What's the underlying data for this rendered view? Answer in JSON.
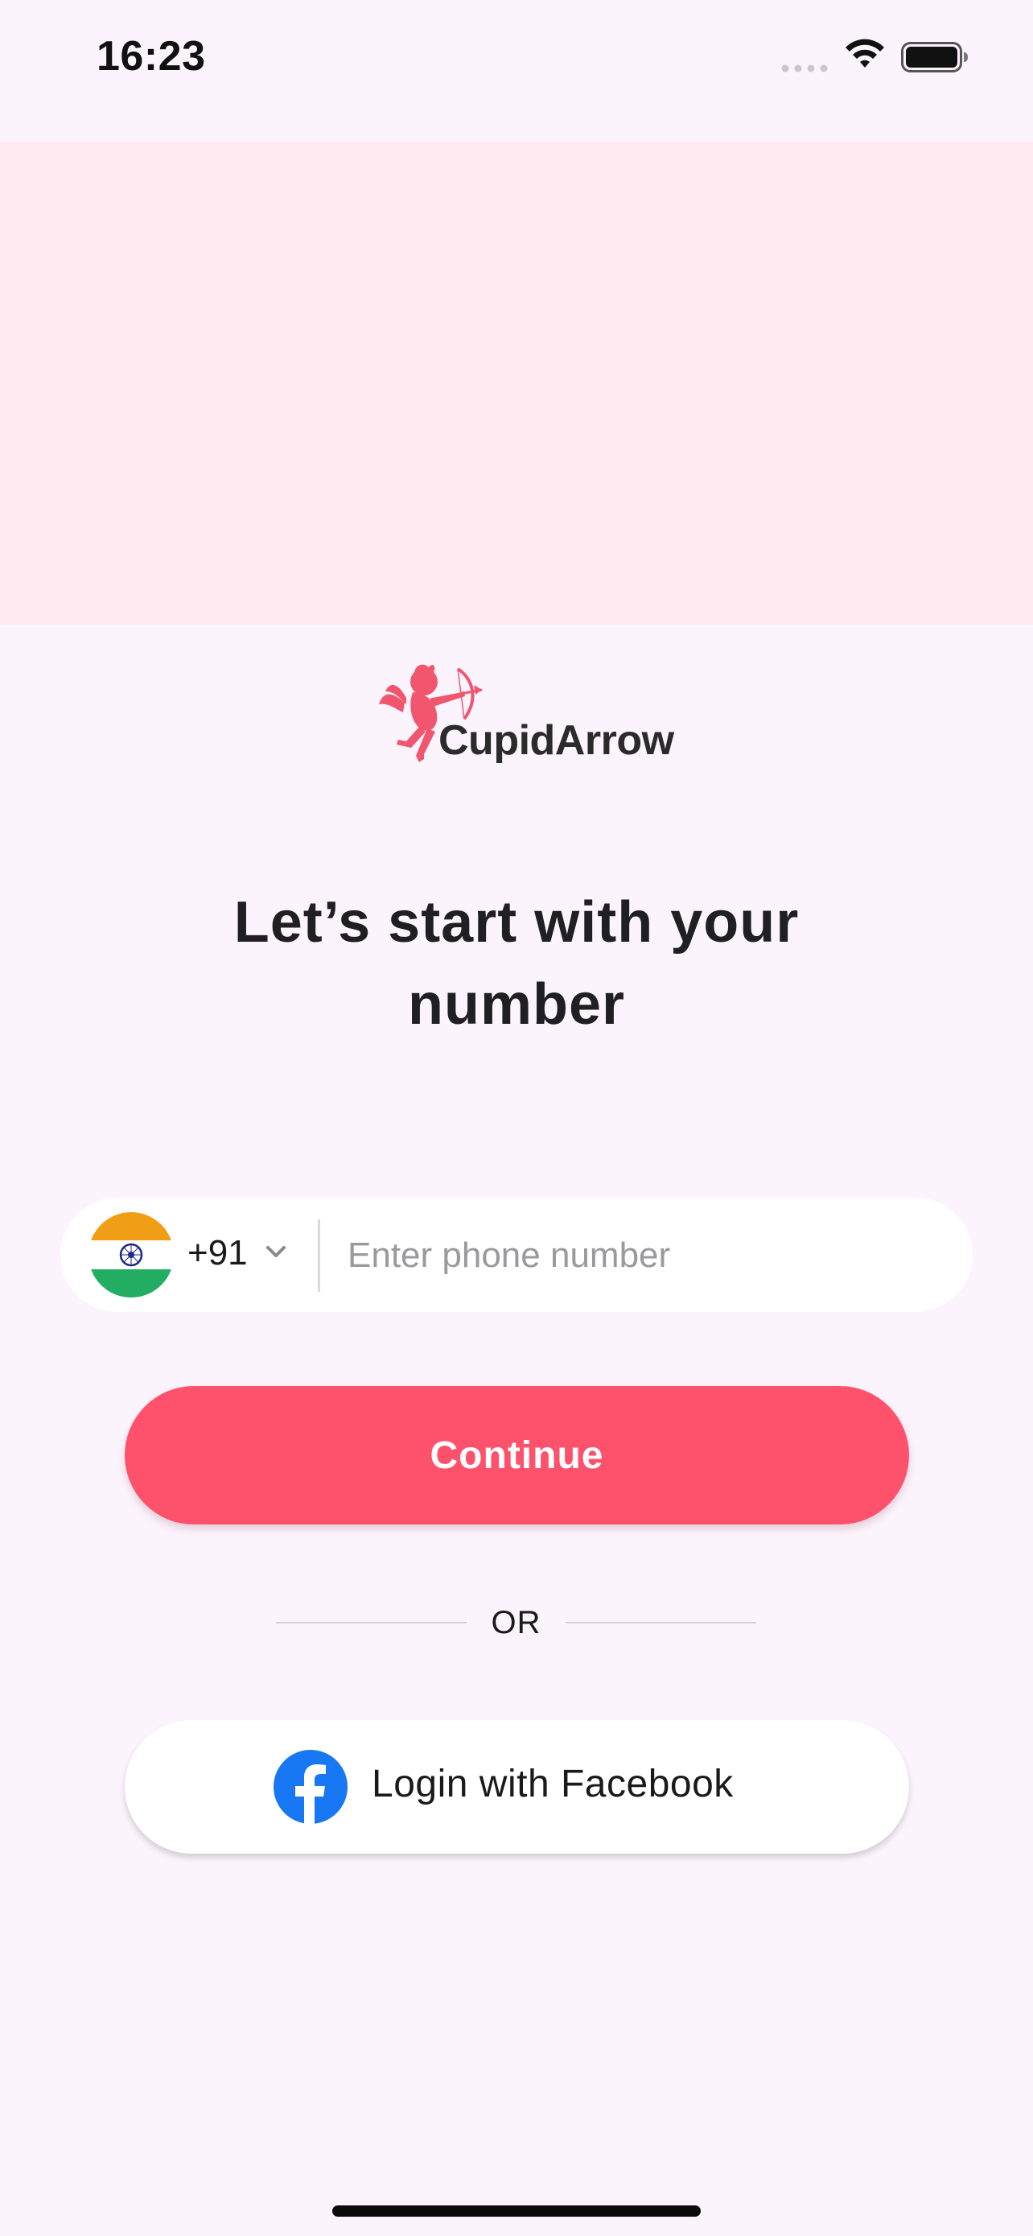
{
  "status_bar": {
    "time": "16:23"
  },
  "brand": {
    "name": "CupidArrow",
    "logo_icon": "cupid-icon",
    "color": "#fe526c"
  },
  "heading": {
    "line1": "Let’s start with your",
    "line2": "number"
  },
  "phone_field": {
    "country_flag": "india-flag-icon",
    "dial_code": "+91",
    "dropdown_icon": "chevron-down-icon",
    "value": "",
    "placeholder": "Enter phone number"
  },
  "continue_button": {
    "label": "Continue",
    "color": "#fe526c"
  },
  "divider": {
    "label": "OR"
  },
  "facebook_button": {
    "label": "Login with Facebook",
    "icon": "facebook-icon",
    "icon_color": "#1877f2"
  },
  "colors": {
    "background": "#fcf4fc",
    "hero": "#fdebf1"
  }
}
